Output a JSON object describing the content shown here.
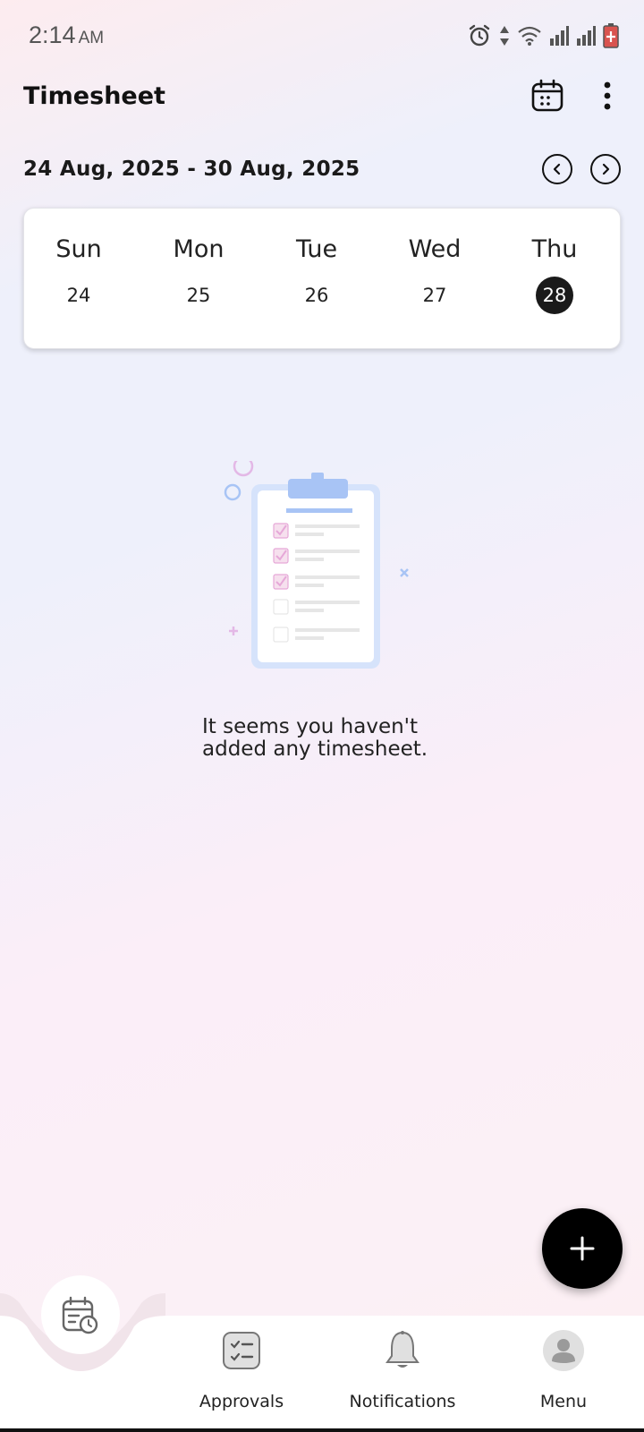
{
  "status_bar": {
    "time": "2:14",
    "ampm": "AM",
    "icons": [
      "alarm-icon",
      "data-arrows-icon",
      "wifi-icon",
      "signal-icon",
      "signal-icon",
      "battery-icon"
    ]
  },
  "header": {
    "title": "Timesheet",
    "calendar_icon": "calendar-icon",
    "more_icon": "more-vert-icon"
  },
  "week": {
    "range": "24 Aug, 2025 - 30 Aug, 2025",
    "prev_icon": "chevron-left-icon",
    "next_icon": "chevron-right-icon"
  },
  "days": [
    {
      "name": "Sun",
      "num": "24",
      "selected": false
    },
    {
      "name": "Mon",
      "num": "25",
      "selected": false
    },
    {
      "name": "Tue",
      "num": "26",
      "selected": false
    },
    {
      "name": "Wed",
      "num": "27",
      "selected": false
    },
    {
      "name": "Thu",
      "num": "28",
      "selected": true
    }
  ],
  "empty_state": {
    "line1": "It seems you haven't",
    "line2": "added any timesheet.",
    "illustration_icon": "clipboard-checklist-icon"
  },
  "fab": {
    "icon": "plus-icon"
  },
  "bottom_nav": {
    "home_icon": "calendar-clock-icon",
    "items": [
      {
        "label": "Approvals",
        "icon": "checklist-icon"
      },
      {
        "label": "Notifications",
        "icon": "bell-icon"
      },
      {
        "label": "Menu",
        "icon": "avatar-icon"
      }
    ]
  },
  "colors": {
    "accent_dark": "#000000",
    "selected_day": "#1a1a1a",
    "illustration_blue": "#a8c4f5",
    "illustration_pink": "#e6a8d8"
  }
}
